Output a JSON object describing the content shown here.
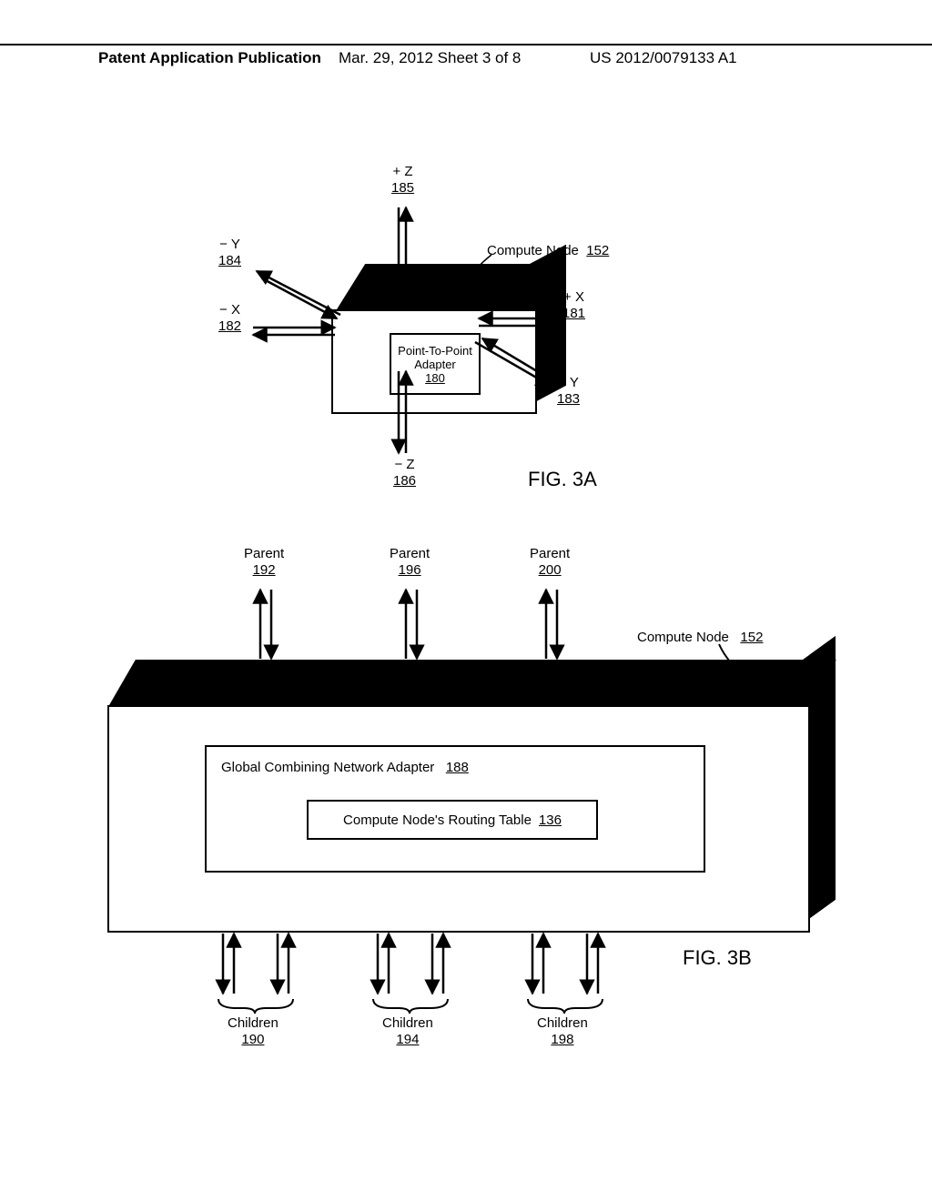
{
  "header": {
    "pub_type": "Patent Application Publication",
    "pub_date": "Mar. 29, 2012  Sheet 3 of 8",
    "pub_num": "US 2012/0079133 A1"
  },
  "fig3a": {
    "caption": "FIG. 3A",
    "compute_node_label": "Compute Node",
    "compute_node_ref": "152",
    "p2p_label_l1": "Point-To-Point",
    "p2p_label_l2": "Adapter",
    "p2p_ref": "180",
    "axes": {
      "plus_z": {
        "label": "+ Z",
        "ref": "185"
      },
      "minus_z": {
        "label": "− Z",
        "ref": "186"
      },
      "plus_x": {
        "label": "+ X",
        "ref": "181"
      },
      "minus_x": {
        "label": "− X",
        "ref": "182"
      },
      "plus_y": {
        "label": "+ Y",
        "ref": "183"
      },
      "minus_y": {
        "label": "− Y",
        "ref": "184"
      }
    }
  },
  "fig3b": {
    "caption": "FIG. 3B",
    "compute_node_label": "Compute Node",
    "compute_node_ref": "152",
    "gcna_label": "Global Combining Network Adapter",
    "gcna_ref": "188",
    "routing_label": "Compute Node's Routing Table",
    "routing_ref": "136",
    "parents": [
      {
        "label": "Parent",
        "ref": "192"
      },
      {
        "label": "Parent",
        "ref": "196"
      },
      {
        "label": "Parent",
        "ref": "200"
      }
    ],
    "children": [
      {
        "label": "Children",
        "ref": "190"
      },
      {
        "label": "Children",
        "ref": "194"
      },
      {
        "label": "Children",
        "ref": "198"
      }
    ]
  }
}
